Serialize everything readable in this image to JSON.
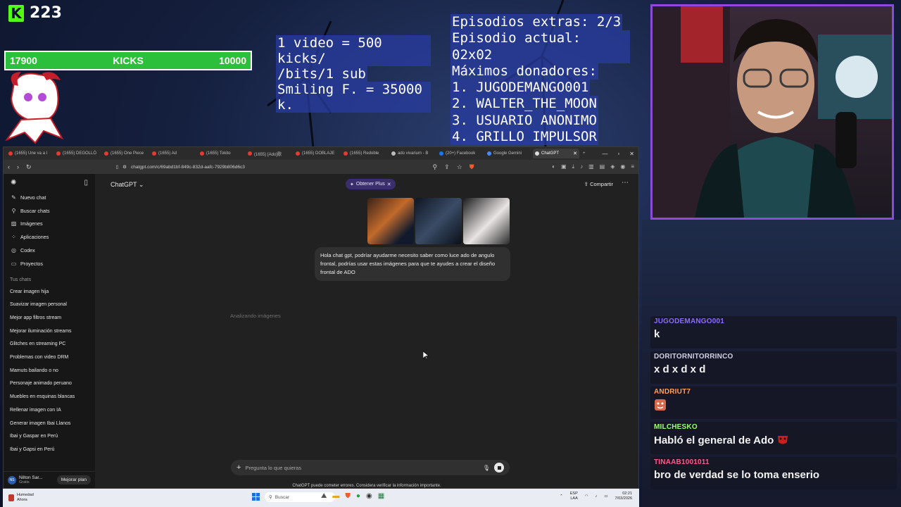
{
  "overlay": {
    "kick_count": "223",
    "kick_bar": {
      "left": "17900",
      "label": "KICKS",
      "right": "10000",
      "progress": 1.0
    },
    "kicks_info": [
      "1 video = 500 kicks/",
      "/bits/1 sub",
      "Smiling F. = 35000 k."
    ],
    "episode_info": [
      "Episodios extras: 2/3",
      "Episodio actual: 02x02",
      "Máximos donadores:",
      "1. JUGODEMANGO001",
      "2. WALTER_THE_MOON",
      "3. USUARIO ANONIMO",
      "4. GRILLO IMPULSOR"
    ]
  },
  "chat": {
    "messages": [
      {
        "user": "JUGODEMANGO001",
        "text": "k",
        "color": "#8a6cff"
      },
      {
        "user": "DORITORNITORRINCO",
        "text": "x d x d x d",
        "color": "#cfcfe8"
      },
      {
        "user": "ANDRIUT7",
        "text": "",
        "emote": "face-emote",
        "color": "#ff9f5a"
      },
      {
        "user": "MILCHESKO",
        "text": "Habló el general de Ado",
        "emote": "mask-emote",
        "color": "#9cff6b"
      },
      {
        "user": "TINAAB1001011",
        "text": "bro de verdad se lo toma enserio",
        "color": "#ff5a8a"
      }
    ]
  },
  "browser": {
    "tabs": [
      {
        "label": "(1655) Une va a l"
      },
      {
        "label": "(1655) DEGOLLÓ"
      },
      {
        "label": "(1655) One Piece"
      },
      {
        "label": "(1655) Ad"
      },
      {
        "label": "(1655) Tokito"
      },
      {
        "label": "(1655) [Ado]歌"
      },
      {
        "label": "(1655) DOBLAJE"
      },
      {
        "label": "(1655) Redoble"
      },
      {
        "label": "ado vivarium - B"
      },
      {
        "label": "(20+) Facebook"
      },
      {
        "label": "Google Gemini"
      },
      {
        "label": "ChatGPT",
        "active": true
      }
    ],
    "url": "chatgpt.com/c/69abd1bf-849c-832d-aafc-7929b806d6c3"
  },
  "app": {
    "model": "ChatGPT",
    "plus_pill": "Obtener Plus",
    "share": "Compartir",
    "sidebar": {
      "items": [
        {
          "label": "Nuevo chat",
          "icon": "new-chat-icon"
        },
        {
          "label": "Buscar chats",
          "icon": "search-icon"
        },
        {
          "label": "Imágenes",
          "icon": "images-icon"
        },
        {
          "label": "Aplicaciones",
          "icon": "apps-icon"
        },
        {
          "label": "Codex",
          "icon": "codex-icon"
        },
        {
          "label": "Proyectos",
          "icon": "folder-icon"
        }
      ],
      "section_title": "Tus chats",
      "chats": [
        "Crear imagen hija",
        "Suavizar imagen personal",
        "Mejor app filtros stream",
        "Mejorar iluminación streams",
        "Glitches en streaming PC",
        "Problemas con video DRM",
        "Mamuts bailando o no",
        "Personaje animado peruano",
        "Muebles en esquinas blancas",
        "Rellenar imagen con IA",
        "Generar imagen Ibai Llanos",
        "Ibai y Gaspar en Perú",
        "Ibai y Gapsi en Perú"
      ],
      "user": {
        "initials": "NS",
        "name": "Nilton Sar...",
        "plan": "Gratis"
      },
      "upgrade": "Mejorar plan"
    },
    "user_message": "Hola chat gpt, podríar ayudarme necesito saber como luce ado de angulo frontal, podrías usar estas imágenes para que te ayudes a crear el diseño frontal de ADO",
    "status": "Analizando imágenes",
    "composer": {
      "placeholder": "Pregunta lo que quieras",
      "value": ""
    },
    "disclaimer": "ChatGPT puede cometer errores. Considera verificar la información importante."
  },
  "taskbar": {
    "weather_title": "Humedad",
    "weather_sub": "Ahora",
    "search_placeholder": "Buscar",
    "lang_1": "ESP",
    "lang_2": "LAA",
    "time": "02:21",
    "date": "7/03/2026"
  }
}
